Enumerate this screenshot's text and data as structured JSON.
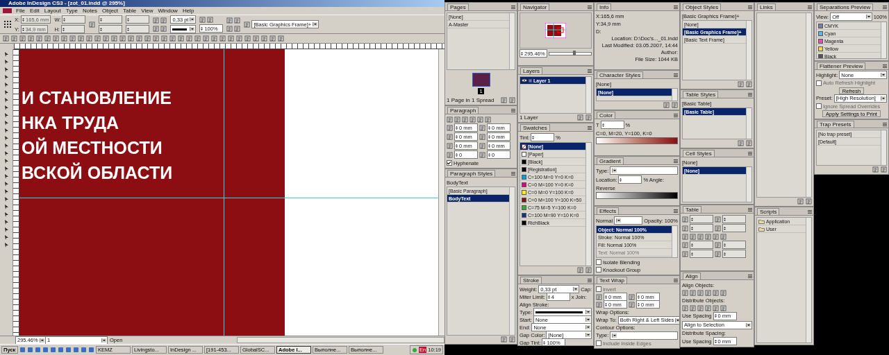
{
  "window": {
    "title": "Adobe InDesign CS3 - [zot_01.indd @ 295%]"
  },
  "menu": [
    "File",
    "Edit",
    "Layout",
    "Type",
    "Notes",
    "Object",
    "Table",
    "View",
    "Window",
    "Help"
  ],
  "control_panel": {
    "x_label": "X:",
    "x": "165,6 mm",
    "y_label": "Y:",
    "y": "34,9 mm",
    "w_label": "W:",
    "h_label": "H:",
    "stroke_weight": "0,33 pt",
    "opacity": "100%",
    "object_style": "[Basic Graphics Frame]+"
  },
  "document": {
    "heading_lines": [
      "И СТАНОВЛЕНИЕ",
      "НКА ТРУДА",
      "ОЙ МЕСТНОСТИ",
      "ВСКОЙ ОБЛАСТИ"
    ]
  },
  "status_bar": {
    "zoom": "295.46%",
    "page": "1",
    "state": "Open"
  },
  "taskbar": {
    "start": "Пуск",
    "tasks": [
      {
        "label": "KEMZ",
        "selected": false
      },
      {
        "label": "Livingsto...",
        "selected": false
      },
      {
        "label": "InDesign ...",
        "selected": false
      },
      {
        "label": "[191-453...",
        "selected": false
      },
      {
        "label": "GlobalSC...",
        "selected": false
      },
      {
        "label": "Adobe I...",
        "selected": true
      },
      {
        "label": "Выполне...",
        "selected": false
      },
      {
        "label": "Выполне...",
        "selected": false
      }
    ],
    "language": "En",
    "clock": "10:19"
  },
  "columns": [
    {
      "panels": [
        {
          "title": "Pages",
          "rows": [
            {
              "kind": "list",
              "items": [
                {
                  "label": "[None]",
                  "selected": false
                },
                {
                  "label": "A-Master",
                  "selected": false
                }
              ]
            },
            {
              "kind": "page-thumb",
              "label": "1"
            },
            {
              "kind": "footer",
              "text": "1 Page in 1 Spread"
            }
          ]
        },
        {
          "title": "Paragraph",
          "rows": [
            {
              "kind": "icons"
            },
            {
              "kind": "fields",
              "values": [
                "0 mm",
                "0 mm"
              ]
            },
            {
              "kind": "fields",
              "values": [
                "0 mm",
                "0 mm"
              ]
            },
            {
              "kind": "fields",
              "values": [
                "0 mm",
                "0 mm"
              ]
            },
            {
              "kind": "fields",
              "values": [
                "0",
                "0"
              ]
            },
            {
              "kind": "check",
              "label": "Hyphenate",
              "checked": true,
              "disabled": false
            }
          ]
        },
        {
          "title": "Paragraph Styles",
          "rows": [
            {
              "kind": "text",
              "text": "BodyText"
            },
            {
              "kind": "list",
              "items": [
                {
                  "label": "[Basic Paragraph]",
                  "selected": false
                },
                {
                  "label": "BodyText",
                  "selected": true
                }
              ]
            },
            {
              "kind": "footer"
            }
          ]
        }
      ]
    },
    {
      "panels": [
        {
          "title": "Navigator",
          "rows": [
            {
              "kind": "preview"
            },
            {
              "kind": "zoom",
              "value": "295.46%",
              "level": 0.6
            }
          ]
        },
        {
          "title": "Layers",
          "rows": [
            {
              "kind": "list",
              "items": [
                {
                  "label": "Layer 1",
                  "selected": true,
                  "kind": "layer"
                }
              ]
            },
            {
              "kind": "footer",
              "text": "1 Layer"
            }
          ]
        },
        {
          "title": "Swatches",
          "rows": [
            {
              "kind": "field-pair",
              "label": "Tint:",
              "suffix": "%"
            },
            {
              "kind": "list",
              "items": [
                {
                  "label": "[None]",
                  "selected": true,
                  "kind": "none"
                },
                {
                  "label": "[Paper]",
                  "selected": false,
                  "kind": "swatch",
                  "color": "#ffffff"
                },
                {
                  "label": "[Black]",
                  "selected": false,
                  "kind": "swatch",
                  "color": "#000000"
                },
                {
                  "label": "[Registration]",
                  "selected": false,
                  "kind": "swatch",
                  "color": "#000000"
                },
                {
                  "label": "C=100 M=0 Y=0 K=0",
                  "selected": false,
                  "kind": "swatch",
                  "color": "#00a0e3"
                },
                {
                  "label": "C=0 M=100 Y=0 K=0",
                  "selected": false,
                  "kind": "swatch",
                  "color": "#e4007c"
                },
                {
                  "label": "C=0 M=0 Y=100 K=0",
                  "selected": false,
                  "kind": "swatch",
                  "color": "#fff100"
                },
                {
                  "label": "C=0 M=100 Y=100 K=50",
                  "selected": false,
                  "kind": "swatch",
                  "color": "#8c0e12"
                },
                {
                  "label": "C=75 M=5 Y=100 K=0",
                  "selected": false,
                  "kind": "swatch",
                  "color": "#3aa935"
                },
                {
                  "label": "C=100 M=90 Y=10 K=0",
                  "selected": false,
                  "kind": "swatch",
                  "color": "#1d2f87"
                },
                {
                  "label": "RichBlack",
                  "selected": false,
                  "kind": "swatch",
                  "color": "#000000"
                }
              ]
            },
            {
              "kind": "footer"
            }
          ]
        },
        {
          "title": "Stroke",
          "rows": [
            {
              "kind": "dropdown-pair",
              "label": "Weight:",
              "value": "0,33 pt",
              "suffix": "Cap:"
            },
            {
              "kind": "field-pair",
              "label": "Miter Limit:",
              "value": "4",
              "suffix": "x   Join:"
            },
            {
              "kind": "text",
              "text": "Align Stroke:"
            },
            {
              "kind": "line-pair",
              "label": "Type:"
            },
            {
              "kind": "dropdown-pair",
              "label": "Start:",
              "value": "None"
            },
            {
              "kind": "dropdown-pair",
              "label": "End:",
              "value": "None"
            },
            {
              "kind": "dropdown-pair",
              "label": "Gap Color:",
              "value": "[None]"
            },
            {
              "kind": "field-pair",
              "label": "Gap Tint:",
              "value": "100%"
            }
          ]
        }
      ]
    },
    {
      "panels": [
        {
          "title": "Info",
          "rows": [
            {
              "kind": "text",
              "text": "X:165,6 mm"
            },
            {
              "kind": "text",
              "text": "Y:34,9 mm"
            },
            {
              "kind": "text",
              "text": "D:"
            },
            {
              "kind": "kv",
              "label": "Location:",
              "value": "D:\\Doc's..._01.indd"
            },
            {
              "kind": "kv",
              "label": "Last Modified:",
              "value": "03.05.2007, 14:44"
            },
            {
              "kind": "kv",
              "label": "Author:"
            },
            {
              "kind": "kv",
              "label": "File Size:",
              "value": "1044 KB"
            }
          ]
        },
        {
          "title": "Character Styles",
          "rows": [
            {
              "kind": "text",
              "text": "[None]"
            },
            {
              "kind": "list",
              "items": [
                {
                  "label": "[None]",
                  "selected": true
                }
              ]
            },
            {
              "kind": "footer"
            }
          ]
        },
        {
          "title": "Color",
          "rows": [
            {
              "kind": "field-pair",
              "label": "T",
              "suffix": "%"
            },
            {
              "kind": "text",
              "text": "C=0, M=20, Y=100, K=0"
            },
            {
              "kind": "color-ramp"
            }
          ]
        },
        {
          "title": "Gradient",
          "rows": [
            {
              "kind": "dropdown-pair",
              "label": "Type:"
            },
            {
              "kind": "field-pair",
              "label": "Location:",
              "suffix": "% Angle:"
            },
            {
              "kind": "text",
              "text": "Reverse"
            },
            {
              "kind": "gray-ramp"
            }
          ]
        },
        {
          "title": "Effects",
          "rows": [
            {
              "kind": "dropdown-pair",
              "label": "Normal",
              "suffix": "Opacity: 100%"
            },
            {
              "kind": "list",
              "items": [
                {
                  "label": "Object: Normal 100%",
                  "selected": true,
                  "disabled": false
                },
                {
                  "label": "Stroke: Normal 100%",
                  "selected": false,
                  "disabled": false
                },
                {
                  "label": "Fill: Normal 100%",
                  "selected": false,
                  "disabled": false
                },
                {
                  "label": "Text: Normal 100%",
                  "selected": false,
                  "disabled": true
                }
              ]
            },
            {
              "kind": "check",
              "label": "Isolate Blending",
              "checked": false,
              "disabled": false
            },
            {
              "kind": "check",
              "label": "Knockout Group",
              "checked": false,
              "disabled": false
            }
          ]
        },
        {
          "title": "Text Wrap",
          "rows": [
            {
              "kind": "check",
              "label": "Invert",
              "checked": false,
              "disabled": true
            },
            {
              "kind": "fields",
              "values": [
                "0 mm",
                "0 mm"
              ]
            },
            {
              "kind": "fields",
              "values": [
                "0 mm",
                "0 mm"
              ]
            },
            {
              "kind": "text",
              "text": "Wrap Options:"
            },
            {
              "kind": "dropdown-pair",
              "label": "Wrap To:",
              "value": "Both Right & Left Sides"
            },
            {
              "kind": "text",
              "text": "Contour Options:"
            },
            {
              "kind": "dropdown-pair",
              "label": "Type:"
            },
            {
              "kind": "check",
              "label": "Include Inside Edges",
              "checked": false,
              "disabled": true
            }
          ]
        }
      ]
    },
    {
      "panels": [
        {
          "title": "Object Styles",
          "rows": [
            {
              "kind": "text",
              "text": "[Basic Graphics Frame]+"
            },
            {
              "kind": "list",
              "items": [
                {
                  "label": "[None]",
                  "selected": false
                },
                {
                  "label": "[Basic Graphics Frame]+",
                  "selected": true
                },
                {
                  "label": "[Basic Text Frame]",
                  "selected": false
                }
              ]
            },
            {
              "kind": "footer"
            }
          ]
        },
        {
          "title": "Table Styles",
          "rows": [
            {
              "kind": "text",
              "text": "[Basic Table]"
            },
            {
              "kind": "list",
              "items": [
                {
                  "label": "[Basic Table]",
                  "selected": true
                }
              ]
            },
            {
              "kind": "footer"
            }
          ]
        },
        {
          "title": "Cell Styles",
          "rows": [
            {
              "kind": "text",
              "text": "[None]"
            },
            {
              "kind": "list",
              "items": [
                {
                  "label": "[None]",
                  "selected": true
                }
              ]
            }
          ]
        },
        {
          "title": "Table",
          "rows": [
            {
              "kind": "fields",
              "values": []
            },
            {
              "kind": "fields",
              "values": []
            },
            {
              "kind": "icons"
            },
            {
              "kind": "fields",
              "values": []
            },
            {
              "kind": "fields",
              "values": []
            }
          ]
        },
        {
          "title": "Align",
          "rows": [
            {
              "kind": "text",
              "text": "Align Objects:"
            },
            {
              "kind": "icons"
            },
            {
              "kind": "text",
              "text": "Distribute Objects:"
            },
            {
              "kind": "icons"
            },
            {
              "kind": "field-pair",
              "label": "Use Spacing",
              "value": "0 mm"
            },
            {
              "kind": "dropdown-pair",
              "value": "Align to Selection"
            },
            {
              "kind": "text",
              "text": "Distribute Spacing:"
            },
            {
              "kind": "field-pair",
              "label": "Use Spacing",
              "value": "0 mm"
            }
          ]
        }
      ]
    },
    {
      "panels": [
        {
          "title": "Links",
          "rows": [
            {
              "kind": "list",
              "items": []
            },
            {
              "kind": "footer"
            }
          ]
        },
        {
          "title": "Scripts",
          "rows": [
            {
              "kind": "list",
              "items": [
                {
                  "label": "Application",
                  "selected": false,
                  "kind": "folder"
                },
                {
                  "label": "User",
                  "selected": false,
                  "kind": "folder"
                }
              ]
            }
          ]
        }
      ]
    },
    {
      "panels": [
        {
          "title": "Separations Preview",
          "rows": [
            {
              "kind": "dropdown-pair",
              "label": "View:",
              "value": "Off",
              "suffix": "100%"
            },
            {
              "kind": "list",
              "items": [
                {
                  "label": "CMYK",
                  "selected": false,
                  "kind": "swatch",
                  "color": "#7a7fa8"
                },
                {
                  "label": "Cyan",
                  "selected": false,
                  "kind": "swatch",
                  "color": "#5bb6e6"
                },
                {
                  "label": "Magenta",
                  "selected": false,
                  "kind": "swatch",
                  "color": "#e24fb0"
                },
                {
                  "label": "Yellow",
                  "selected": false,
                  "kind": "swatch",
                  "color": "#f0d84a"
                },
                {
                  "label": "Black",
                  "selected": false,
                  "kind": "swatch",
                  "color": "#555555"
                }
              ]
            }
          ]
        },
        {
          "title": "Flattener Preview",
          "rows": [
            {
              "kind": "dropdown-pair",
              "label": "Highlight:",
              "value": "None"
            },
            {
              "kind": "check",
              "label": "Auto Refresh Highlight",
              "checked": false,
              "disabled": true
            },
            {
              "kind": "button",
              "label": "Refresh"
            },
            {
              "kind": "dropdown-pair",
              "label": "Preset:",
              "value": "[High Resolution]"
            },
            {
              "kind": "check",
              "label": "Ignore Spread Overrides",
              "checked": false,
              "disabled": true
            },
            {
              "kind": "button",
              "label": "Apply Settings to Print"
            }
          ]
        },
        {
          "title": "Trap Presets",
          "rows": [
            {
              "kind": "list",
              "items": [
                {
                  "label": "[No trap preset]",
                  "selected": false
                },
                {
                  "label": "[Default]",
                  "selected": false
                }
              ]
            },
            {
              "kind": "footer"
            }
          ]
        }
      ]
    }
  ]
}
